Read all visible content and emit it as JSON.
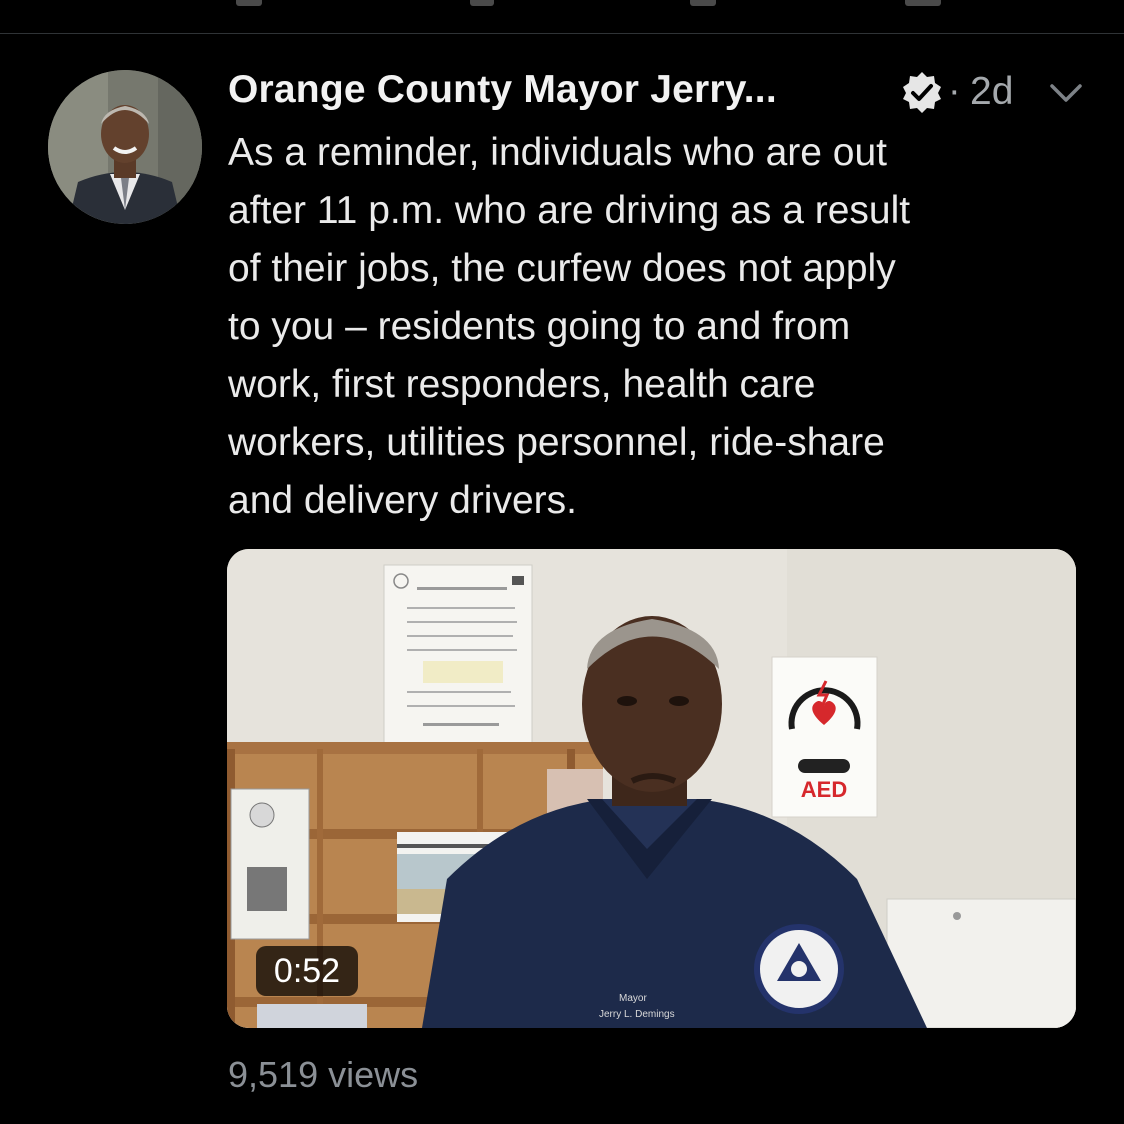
{
  "tweet": {
    "display_name": "Orange County Mayor Jerry...",
    "time_ago": "2d",
    "separator": "·",
    "text": "As a reminder, individuals who are out\nafter 11 p.m. who are driving as a result\nof their jobs, the curfew does not apply\nto you – residents going to and from\nwork, first responders, health care\nworkers, utilities personnel, ride-share\nand delivery drivers.",
    "video": {
      "duration": "0:52",
      "scene_labels": {
        "aed_sign": "AED",
        "shirt_title": "Mayor",
        "shirt_name": "Jerry L. Demings"
      }
    },
    "views": "9,519 views"
  },
  "colors": {
    "background": "#000000",
    "primary_text": "#eaeaea",
    "secondary_text": "#8b9096",
    "divider": "#2f3336"
  },
  "icons": {
    "verified": "verified-badge-icon",
    "menu": "chevron-down-icon"
  }
}
